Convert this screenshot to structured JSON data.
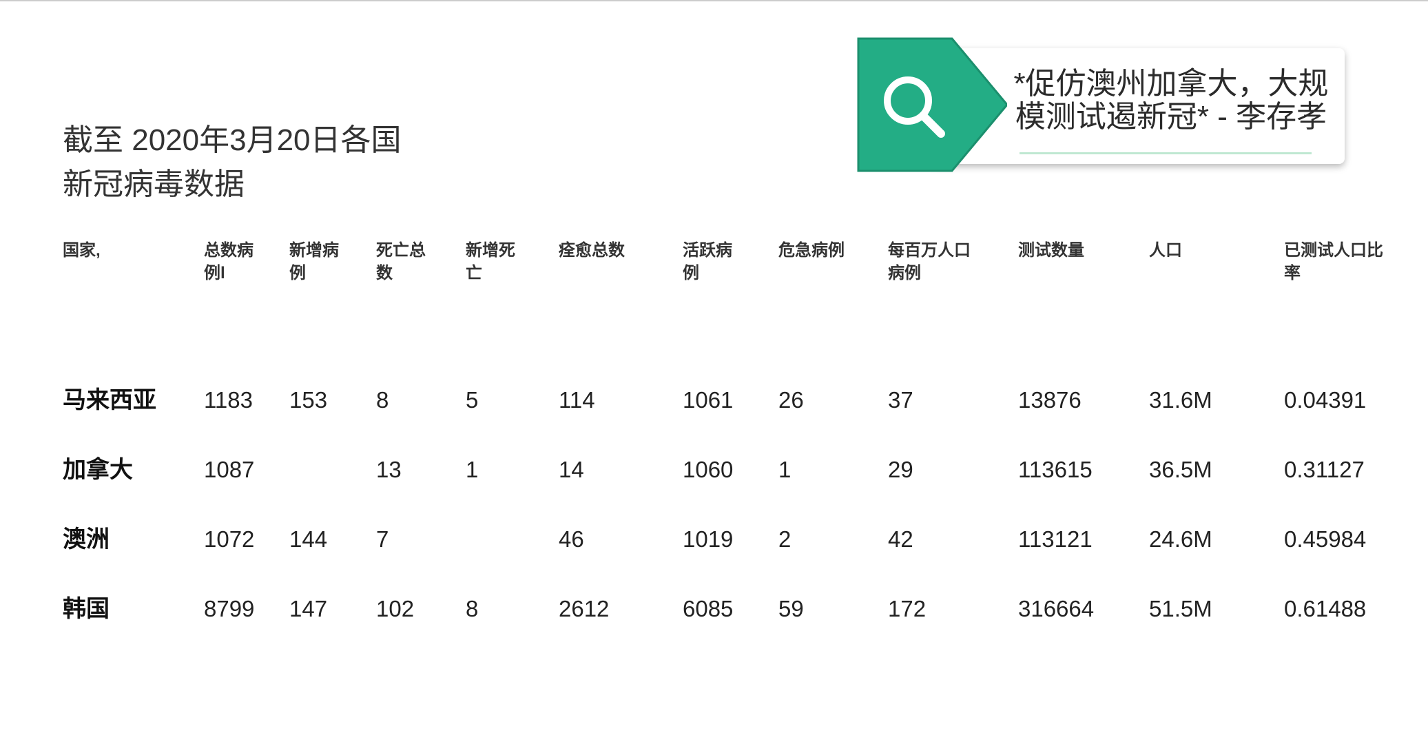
{
  "title_lines": [
    "截至 2020年3月20日各国",
    "新冠病毒数据"
  ],
  "callout": {
    "icon": "search-icon",
    "text_lines": [
      "*促仿澳州加拿大，大规",
      "模测试遏新冠* - 李存孝"
    ],
    "accent_color": "#23ad85"
  },
  "table": {
    "headers": [
      [
        "国家,"
      ],
      [
        "总数病",
        "例l"
      ],
      [
        "新增病",
        "例"
      ],
      [
        "死亡总",
        "数"
      ],
      [
        "新增死",
        "亡"
      ],
      [
        "痊愈总数"
      ],
      [
        "活跃病",
        "例"
      ],
      [
        "危急病例"
      ],
      [
        "每百万人口",
        "病例"
      ],
      [
        "测试数量"
      ],
      [
        "人口"
      ],
      [
        "已测试人口比",
        "率"
      ]
    ],
    "rows": [
      [
        "马来西亚",
        "1183",
        "153",
        "8",
        "5",
        "114",
        "1061",
        "26",
        "37",
        "13876",
        "31.6M",
        "0.04391"
      ],
      [
        "加拿大",
        "1087",
        "",
        "13",
        "1",
        "14",
        "1060",
        "1",
        "29",
        "113615",
        "36.5M",
        "0.31127"
      ],
      [
        "澳洲",
        "1072",
        "144",
        "7",
        "",
        "46",
        "1019",
        "2",
        "42",
        "113121",
        "24.6M",
        "0.45984"
      ],
      [
        "韩国",
        "8799",
        "147",
        "102",
        "8",
        "2612",
        "6085",
        "59",
        "172",
        "316664",
        "51.5M",
        "0.61488"
      ]
    ]
  }
}
